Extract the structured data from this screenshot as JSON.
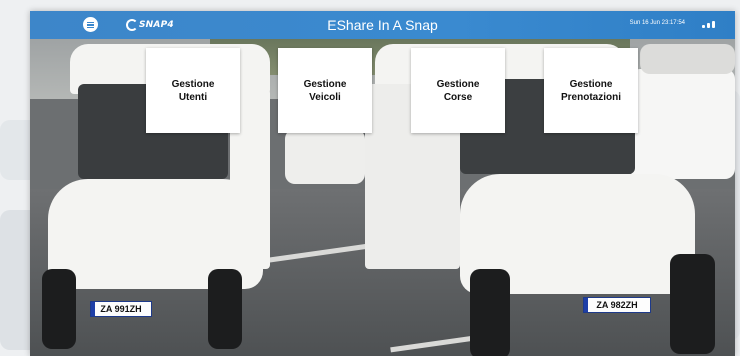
{
  "header": {
    "logo_text": "SNAP4",
    "title": "EShare In A Snap",
    "datetime": "Sun 16 Jun 23:17:54"
  },
  "tiles": [
    {
      "line1": "Gestione",
      "line2": "Utenti"
    },
    {
      "line1": "Gestione",
      "line2": "Veicoli"
    },
    {
      "line1": "Gestione",
      "line2": "Corse"
    },
    {
      "line1": "Gestione",
      "line2": "Prenotazioni"
    }
  ],
  "photo": {
    "plates": [
      "ZA 991ZH",
      "ZA 982ZH"
    ]
  },
  "colors": {
    "header_blue": "#3a8ad0",
    "tile_bg": "#ffffff"
  },
  "icons": {
    "menu": "hamburger-icon",
    "status": "signal-icon"
  }
}
